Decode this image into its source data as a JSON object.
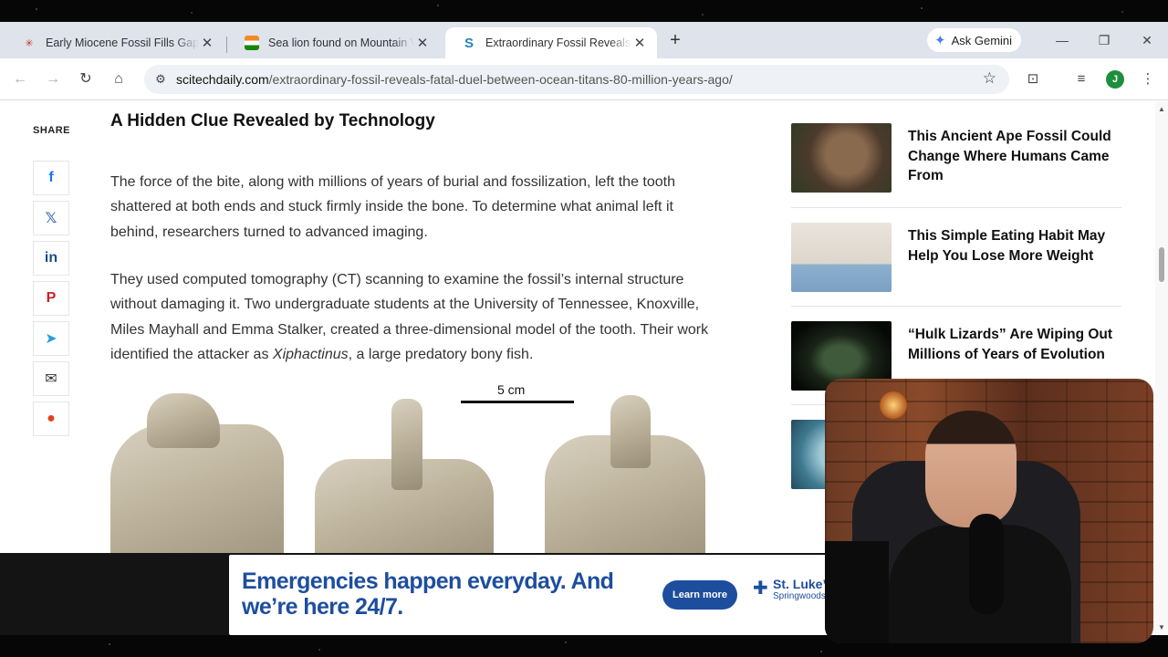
{
  "browser": {
    "tabs": [
      {
        "title": "Early Miocene Fossil Fills Gap in",
        "favicon": "red-star-icon",
        "active": false
      },
      {
        "title": "Sea lion found on Mountain Vie",
        "favicon": "india-flag-icon",
        "active": false
      },
      {
        "title": "Extraordinary Fossil Reveals Fata",
        "favicon": "s-logo-icon",
        "active": true
      }
    ],
    "gemini_label": "Ask Gemini",
    "url_domain": "scitechdaily.com",
    "url_path": "/extraordinary-fossil-reveals-fatal-duel-between-ocean-titans-80-million-years-ago/",
    "profile_initial": "J"
  },
  "share": {
    "label": "SHARE",
    "buttons": [
      "facebook-icon",
      "x-icon",
      "linkedin-icon",
      "pinterest-icon",
      "telegram-icon",
      "email-icon",
      "reddit-icon"
    ]
  },
  "article": {
    "heading": "A Hidden Clue Revealed by Technology",
    "para1": "The force of the bite, along with millions of years of burial and fossilization, left the tooth shattered at both ends and stuck firmly inside the bone. To determine what animal left it behind, researchers turned to advanced imaging.",
    "para2_before": "They used computed tomography (CT) scanning to examine the fossil’s internal structure without damaging it. Two undergraduate students at the University of Tennessee, Knoxville, Miles Mayhall and Emma Stalker, created a three-dimensional model of the tooth. Their work identified the attacker as ",
    "para2_italic": "Xiphactinus",
    "para2_after": ", a large predatory bony fish.",
    "figure_scale": "5 cm"
  },
  "sidebar": {
    "cards": [
      {
        "title": "This Ancient Ape Fossil Could Change Where Humans Came From"
      },
      {
        "title": "This Simple Eating Habit May Help You Lose More Weight"
      },
      {
        "title": "“Hulk Lizards” Are Wiping Out Millions of Years of Evolution"
      },
      {
        "title": ""
      }
    ]
  },
  "ad": {
    "headline": "Emergencies happen everyday. And we’re here 24/7.",
    "cta": "Learn more",
    "brand": "St. Luke’s",
    "brand_sub": "Springwoods",
    "color": "#1d4e9e"
  },
  "colors": {
    "tabstrip": "#dfe3eb",
    "accent_link": "#1d4e9e",
    "facebook": "#1877f2",
    "x": "#3b6ea8",
    "linkedin": "#1a4e8a",
    "pinterest": "#c8232c",
    "telegram": "#2a9fd6",
    "reddit": "#e0431b"
  }
}
